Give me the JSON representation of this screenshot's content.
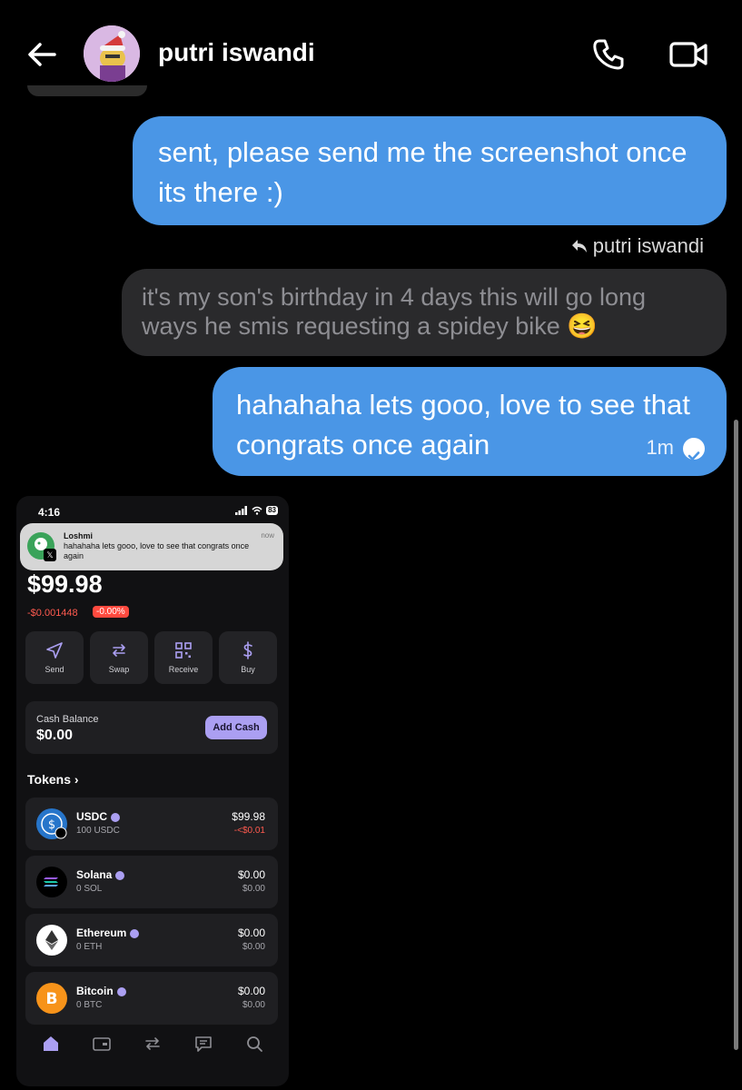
{
  "chat": {
    "name": "putri iswandi",
    "reply_ref": "putri iswandi",
    "messages": [
      {
        "direction": "outgoing",
        "text": "sent, please send me the screenshot once its there :)"
      },
      {
        "direction": "incoming",
        "text": "it's my son's birthday in 4 days this will go long ways he smis requesting a spidey bike 😆"
      },
      {
        "direction": "outgoing",
        "text": "hahahaha lets gooo, love to see that congrats once again",
        "time": "1m"
      }
    ]
  },
  "shot": {
    "status_time": "4:16",
    "battery": "83",
    "notification": {
      "app": "Loshmi",
      "time": "now",
      "body": "hahahaha lets gooo, love to see that congrats once again"
    },
    "balance": "$99.98",
    "change_amount": "-$0.001448",
    "change_percent": "-0.00%",
    "actions": [
      "Send",
      "Swap",
      "Receive",
      "Buy"
    ],
    "cash": {
      "label": "Cash Balance",
      "value": "$0.00",
      "button": "Add Cash"
    },
    "tokens_title": "Tokens",
    "tokens": [
      {
        "name": "USDC",
        "qty": "100 USDC",
        "value": "$99.98",
        "change": "-<$0.01"
      },
      {
        "name": "Solana",
        "qty": "0 SOL",
        "value": "$0.00",
        "change": "$0.00"
      },
      {
        "name": "Ethereum",
        "qty": "0 ETH",
        "value": "$0.00",
        "change": "$0.00"
      },
      {
        "name": "Bitcoin",
        "qty": "0 BTC",
        "value": "$0.00",
        "change": "$0.00"
      }
    ],
    "tabs": [
      "home-icon",
      "wallet-icon",
      "swap-icon",
      "activity-icon",
      "search-icon"
    ]
  },
  "colors": {
    "outgoing_bubble": "#4a96e6",
    "incoming_bubble": "#2a2a2c",
    "accent_purple": "#ab9ff2",
    "negative_red": "#ff5a4f"
  }
}
